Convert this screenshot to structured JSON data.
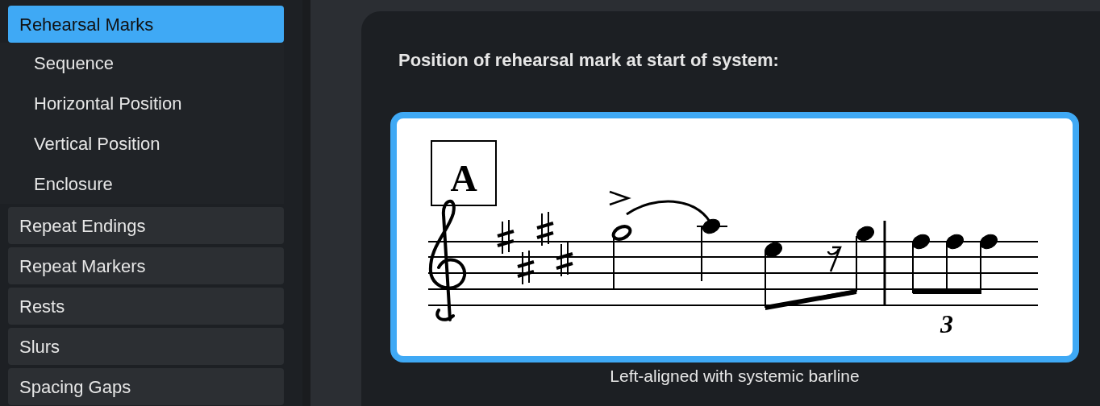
{
  "sidebar": {
    "items": [
      {
        "label": "Rehearsal Marks",
        "selected": true,
        "expanded": true,
        "children": [
          {
            "label": "Sequence",
            "selected": false
          },
          {
            "label": "Horizontal Position",
            "selected": false
          },
          {
            "label": "Vertical Position",
            "selected": false
          },
          {
            "label": "Enclosure",
            "selected": false
          }
        ]
      },
      {
        "label": "Repeat Endings",
        "selected": false
      },
      {
        "label": "Repeat Markers",
        "selected": false
      },
      {
        "label": "Rests",
        "selected": false
      },
      {
        "label": "Slurs",
        "selected": false
      },
      {
        "label": "Spacing Gaps",
        "selected": false
      }
    ]
  },
  "option": {
    "heading": "Position of rehearsal mark at start of system:",
    "choice": {
      "selected": true,
      "rehearsal_mark": "A",
      "tuplet_number": "3",
      "caption": "Left-aligned with systemic barline"
    }
  }
}
